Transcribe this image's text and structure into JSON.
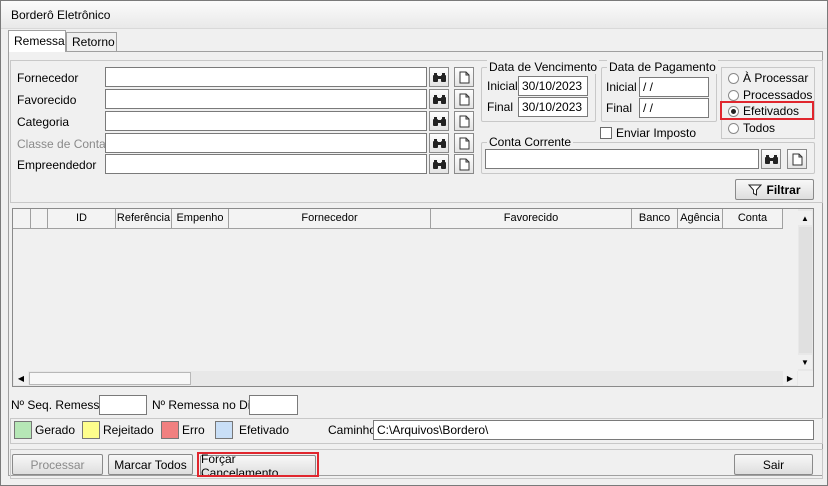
{
  "window": {
    "title": "Borderô Eletrônico"
  },
  "tabs": [
    {
      "label": "Remessa"
    },
    {
      "label": "Retorno"
    }
  ],
  "filters": {
    "fornecedor": {
      "label": "Fornecedor",
      "value": ""
    },
    "favorecido": {
      "label": "Favorecido",
      "value": ""
    },
    "categoria": {
      "label": "Categoria",
      "value": ""
    },
    "classe_conta": {
      "label": "Classe de Conta",
      "value": ""
    },
    "empreendedor": {
      "label": "Empreendedor",
      "value": ""
    }
  },
  "vencimento": {
    "title": "Data de Vencimento",
    "inicial_label": "Inicial",
    "inicial_value": "30/10/2023",
    "final_label": "Final",
    "final_value": "30/10/2023"
  },
  "pagamento": {
    "title": "Data de Pagamento",
    "inicial_label": "Inicial",
    "inicial_value": " / /",
    "final_label": "Final",
    "final_value": " / /"
  },
  "enviar_imposto": {
    "label": "Enviar Imposto",
    "checked": false
  },
  "status_options": [
    {
      "label": "À Processar",
      "selected": false
    },
    {
      "label": "Processados",
      "selected": false
    },
    {
      "label": "Efetivados",
      "selected": true
    },
    {
      "label": "Todos",
      "selected": false
    }
  ],
  "conta_corrente": {
    "title": "Conta Corrente",
    "value": ""
  },
  "filtrar_button": {
    "label": "Filtrar"
  },
  "grid": {
    "columns": [
      "",
      "ID",
      "Referência",
      "Empenho",
      "Fornecedor",
      "Favorecido",
      "Banco",
      "Agência",
      "Conta"
    ],
    "rows": []
  },
  "remessa": {
    "seq_label": "Nº Seq. Remessa",
    "seq_value": "",
    "dia_label": "Nº Remessa no Dia",
    "dia_value": ""
  },
  "legend": [
    {
      "label": "Gerado",
      "color": "#b6e7b6"
    },
    {
      "label": "Rejeitado",
      "color": "#fdfd8c"
    },
    {
      "label": "Erro",
      "color": "#f08080"
    },
    {
      "label": "Efetivado",
      "color": "#c9dff7"
    }
  ],
  "caminho": {
    "label": "Caminho",
    "value": "C:\\Arquivos\\Bordero\\"
  },
  "buttons": {
    "processar": "Processar",
    "marcar_todos": "Marcar Todos",
    "forcar_cancelamento": "Forçar Cancelamento",
    "sair": "Sair"
  },
  "colors": {
    "highlight": "#e0262e"
  }
}
